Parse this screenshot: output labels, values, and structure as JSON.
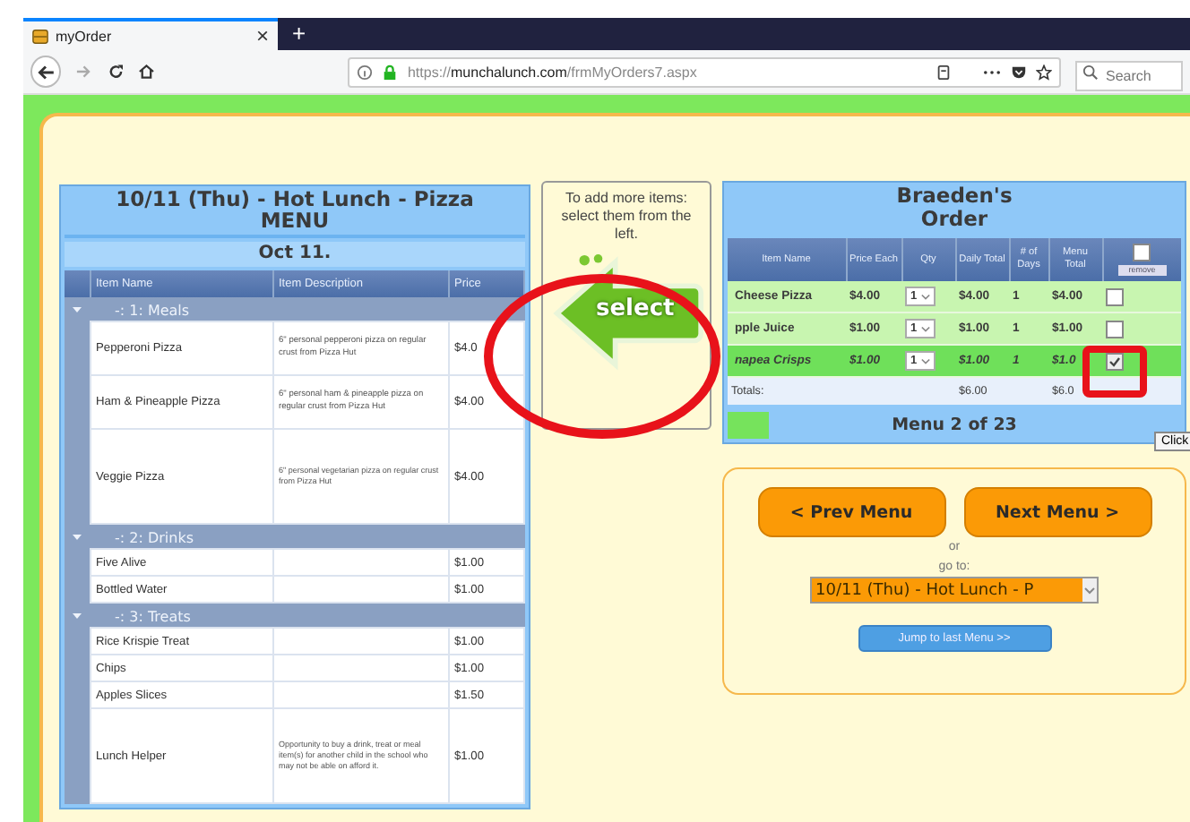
{
  "browser": {
    "tab": {
      "title": "myOrder",
      "close": "×"
    },
    "new_tab": "+",
    "url_plain": "https://",
    "url_domain": "munchalunch.com",
    "url_path": "/frmMyOrders7.aspx",
    "search": {
      "placeholder": "Search"
    }
  },
  "menu": {
    "title": "10/11 (Thu) - Hot Lunch - Pizza MENU",
    "date": "Oct 11.",
    "columns": [
      "Item Name",
      "Item Description",
      "Price"
    ],
    "groups": [
      {
        "label": "-: 1: Meals",
        "expanded": true,
        "items": [
          {
            "name": "Pepperoni Pizza",
            "description": "6\" personal pepperoni pizza on regular crust from Pizza Hut",
            "price": "$4.0"
          },
          {
            "name": "Ham & Pineapple Pizza",
            "description": "6\" personal ham & pineapple pizza on regular crust from Pizza Hut",
            "price": "$4.00"
          },
          {
            "name": "Veggie Pizza",
            "description": "6\" personal vegetarian pizza on regular crust from Pizza Hut",
            "price": "$4.00"
          }
        ]
      },
      {
        "label": "-: 2: Drinks",
        "expanded": true,
        "items": [
          {
            "name": "Five Alive",
            "price": "$1.00"
          },
          {
            "name": "Bottled Water",
            "price": "$1.00"
          }
        ]
      },
      {
        "label": "-: 3: Treats",
        "expanded": true,
        "items": [
          {
            "name": "Rice Krispie Treat",
            "price": "$1.00"
          },
          {
            "name": "Chips",
            "price": "$1.00"
          },
          {
            "name": "Apples Slices",
            "price": "$1.50"
          },
          {
            "name": "Lunch Helper",
            "description": "Opportunity to buy a drink, treat or meal item(s) for another child in the school who may not be able on afford it.",
            "price": "$1.00"
          }
        ]
      }
    ]
  },
  "hint": {
    "text": "To add more items: select them from the left.",
    "button": "select"
  },
  "order": {
    "title": "Braeden's Order",
    "columns": [
      "Item Name",
      "Price Each",
      "Qty",
      "Daily Total",
      "# of Days",
      "Menu Total"
    ],
    "remove_all": {
      "checked": false,
      "button": "remove"
    },
    "rows": [
      {
        "name": "Cheese Pizza",
        "price": "$4.00",
        "qty": "1",
        "daily": "$4.00",
        "days": "1",
        "total": "$4.00",
        "checked": false,
        "selected": false
      },
      {
        "name": "pple Juice",
        "price": "$1.00",
        "qty": "1",
        "daily": "$1.00",
        "days": "1",
        "total": "$1.00",
        "checked": false,
        "selected": false
      },
      {
        "name": "napea Crisps",
        "price": "$1.00",
        "qty": "1",
        "daily": "$1.00",
        "days": "1",
        "total": "$1.0",
        "checked": true,
        "selected": true
      }
    ],
    "totals": {
      "label": "Totals:",
      "daily": "$6.00",
      "total": "$6.0"
    },
    "progress": {
      "label": "Menu 2 of 23",
      "level": 0.09
    }
  },
  "nav": {
    "prev": "< Prev Menu",
    "next": "Next Menu >",
    "or": "or",
    "goto": "go to:",
    "select_value": "10/11 (Thu) - Hot Lunch - P",
    "jump": "Jump to last Menu >>"
  },
  "tooltip": "Click",
  "annotations": [
    {
      "kind": "ellipse"
    },
    {
      "kind": "rectangle"
    }
  ]
}
